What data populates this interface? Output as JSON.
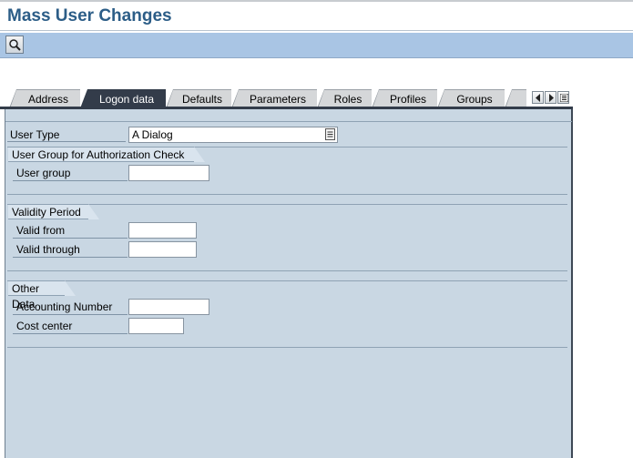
{
  "page": {
    "title": "Mass User Changes"
  },
  "toolbar": {
    "button_icon": "find-icon"
  },
  "tabs": [
    {
      "label": "Address",
      "active": false
    },
    {
      "label": "Logon data",
      "active": true
    },
    {
      "label": "Defaults",
      "active": false
    },
    {
      "label": "Parameters",
      "active": false
    },
    {
      "label": "Roles",
      "active": false
    },
    {
      "label": "Profiles",
      "active": false
    },
    {
      "label": "Groups",
      "active": false
    }
  ],
  "form": {
    "user_type": {
      "label": "User Type",
      "value": "A Dialog"
    },
    "auth_group": {
      "title": "User Group for Authorization Check",
      "user_group": {
        "label": "User group",
        "value": ""
      }
    },
    "validity": {
      "title": "Validity Period",
      "valid_from": {
        "label": "Valid from",
        "value": ""
      },
      "valid_through": {
        "label": "Valid through",
        "value": ""
      }
    },
    "other": {
      "title": "Other Data",
      "accounting_number": {
        "label": "Accounting Number",
        "value": ""
      },
      "cost_center": {
        "label": "Cost center",
        "value": ""
      }
    }
  },
  "colors": {
    "title": "#2c5d87",
    "toolbar": "#a9c5e4",
    "panel": "#c9d7e3",
    "active_tab": "#333c4a"
  }
}
